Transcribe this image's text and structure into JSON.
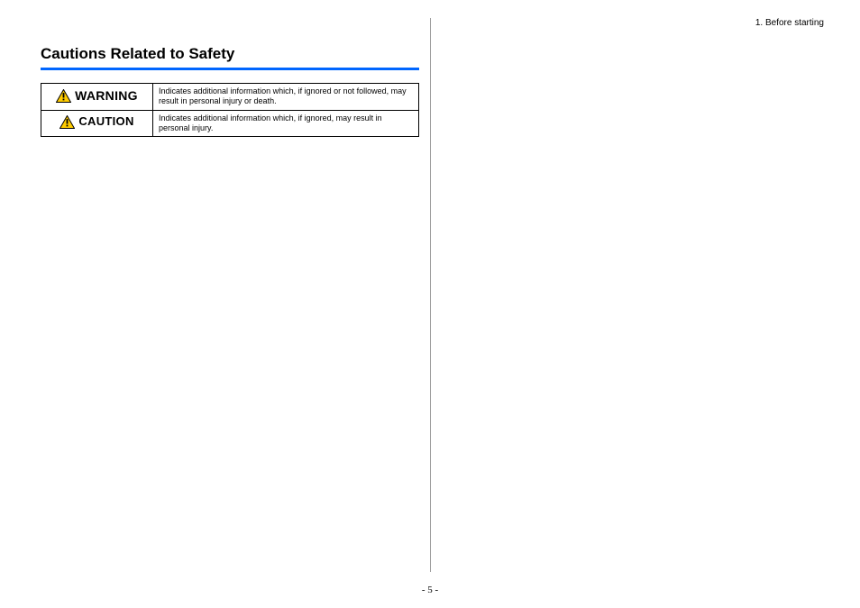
{
  "header": {
    "section_label": "1. Before starting"
  },
  "title": "Cautions Related to Safety",
  "rows": [
    {
      "label": "WARNING",
      "description": "Indicates additional information which, if ignored or not followed, may result in personal injury or death."
    },
    {
      "label": "CAUTION",
      "description": "Indicates additional information which, if ignored, may result in personal injury."
    }
  ],
  "page_number": "- 5 -"
}
